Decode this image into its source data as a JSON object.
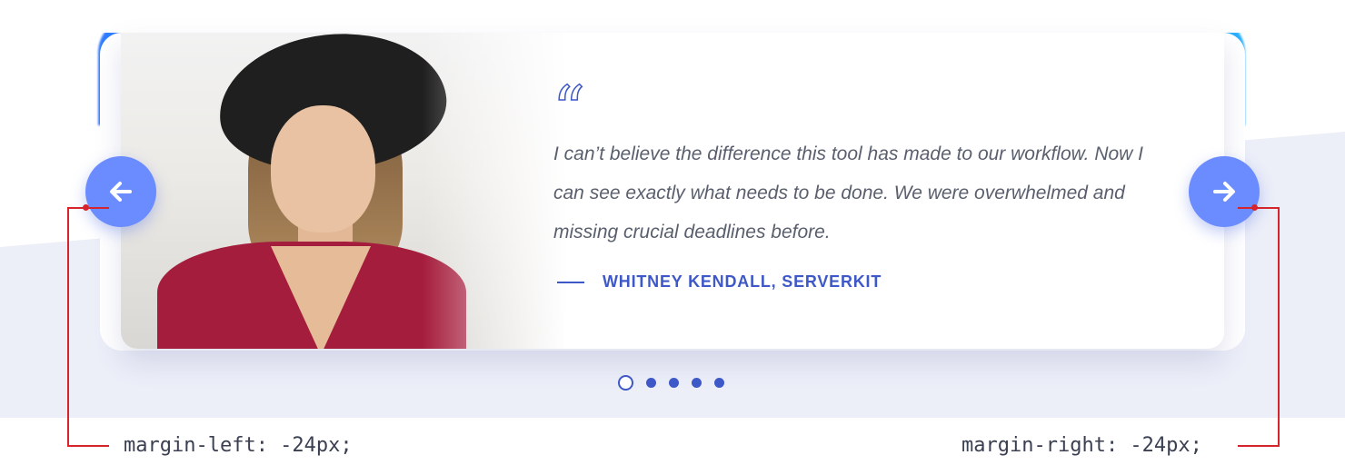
{
  "testimonial": {
    "quote_glyph": "“",
    "text": "I can’t believe the difference this tool has made to our workflow. Now I can see exactly what needs to be done. We were overwhelmed and missing crucial deadlines before.",
    "author": "WHITNEY KENDALL, SERVERKIT"
  },
  "carousel": {
    "prev_icon": "arrow-left-icon",
    "next_icon": "arrow-right-icon",
    "dot_count": 5,
    "active_dot": 1
  },
  "annotations": {
    "left": "margin-left: -24px;",
    "right": "margin-right: -24px;"
  },
  "colors": {
    "accent": "#3e58c8",
    "arrow_button": "#6b8cff",
    "annotation": "#d6242c",
    "panel": "#eceef8"
  }
}
